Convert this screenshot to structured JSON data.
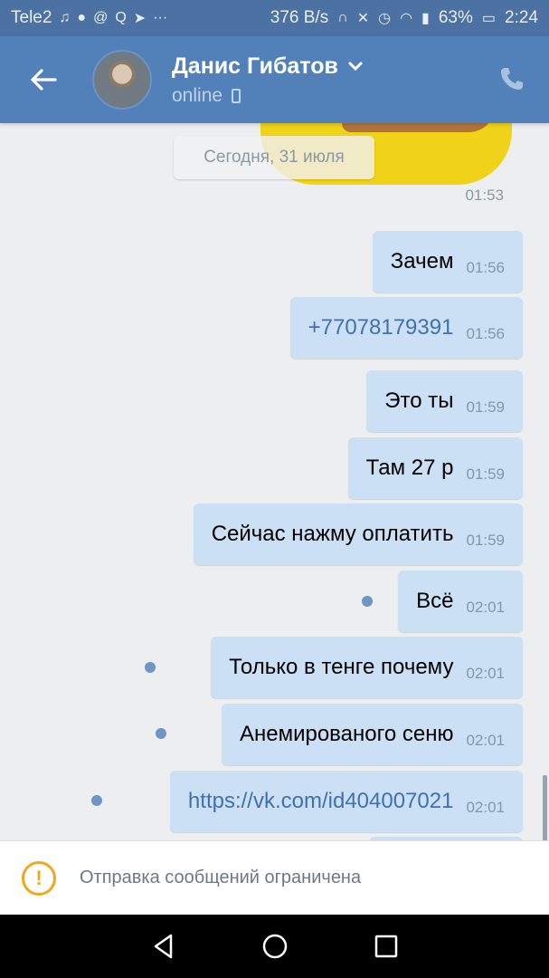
{
  "status_bar": {
    "carrier": "Tele2",
    "speed": "376 B/s",
    "battery": "63%",
    "time": "2:24"
  },
  "header": {
    "contact_name": "Данис Гибатов",
    "status": "online"
  },
  "chat": {
    "sticker_time": "01:53",
    "date_chip": "Сегодня, 31 июля",
    "messages": [
      {
        "text": "Зачем",
        "time": "01:56",
        "link": false,
        "unread": false
      },
      {
        "text": "+77078179391",
        "time": "01:56",
        "link": true,
        "unread": false
      },
      {
        "text": "Это ты",
        "time": "01:59",
        "link": false,
        "unread": false
      },
      {
        "text": "Там 27 р",
        "time": "01:59",
        "link": false,
        "unread": false
      },
      {
        "text": "Сейчас нажму оплатить",
        "time": "01:59",
        "link": false,
        "unread": false
      },
      {
        "text": "Всё",
        "time": "02:01",
        "link": false,
        "unread": true
      },
      {
        "text": "Только в тенге почему",
        "time": "02:01",
        "link": false,
        "unread": true
      },
      {
        "text": "Анемированого сеню",
        "time": "02:01",
        "link": false,
        "unread": true
      },
      {
        "text": "https://vk.com/id404007021",
        "time": "02:01",
        "link": true,
        "unread": true
      }
    ]
  },
  "restriction": {
    "text": "Отправка сообщений ограничена",
    "icon": "warning-icon"
  },
  "colors": {
    "header": "#5181b8",
    "bubble_out": "#cce0f5",
    "link": "#3f70b2",
    "warning": "#f3a51b"
  }
}
